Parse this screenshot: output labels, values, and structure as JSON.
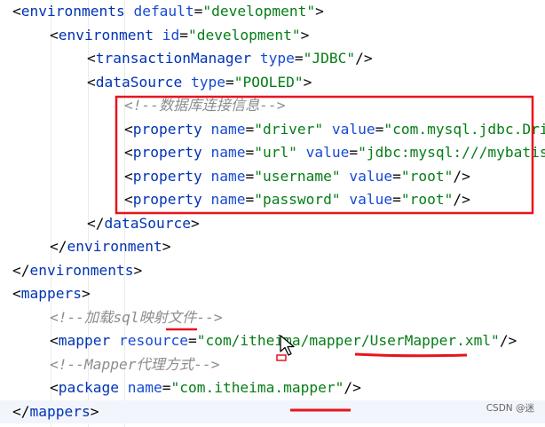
{
  "lines": [
    {
      "level": 0,
      "tokens": [
        {
          "t": "<",
          "c": "punct"
        },
        {
          "t": "environments",
          "c": "tag"
        },
        {
          "t": " default",
          "c": "attr"
        },
        {
          "t": "=",
          "c": "punct"
        },
        {
          "t": "\"development\"",
          "c": "val"
        },
        {
          "t": ">",
          "c": "punct"
        }
      ]
    },
    {
      "level": 1,
      "tokens": [
        {
          "t": "<",
          "c": "punct"
        },
        {
          "t": "environment",
          "c": "tag"
        },
        {
          "t": " id",
          "c": "attr"
        },
        {
          "t": "=",
          "c": "punct"
        },
        {
          "t": "\"development\"",
          "c": "val"
        },
        {
          "t": ">",
          "c": "punct"
        }
      ]
    },
    {
      "level": 2,
      "tokens": [
        {
          "t": "<",
          "c": "punct"
        },
        {
          "t": "transactionManager",
          "c": "tag"
        },
        {
          "t": " type",
          "c": "attr"
        },
        {
          "t": "=",
          "c": "punct"
        },
        {
          "t": "\"JDBC\"",
          "c": "val"
        },
        {
          "t": "/>",
          "c": "punct"
        }
      ]
    },
    {
      "level": 2,
      "tokens": [
        {
          "t": "<",
          "c": "punct"
        },
        {
          "t": "dataSource",
          "c": "tag"
        },
        {
          "t": " type",
          "c": "attr"
        },
        {
          "t": "=",
          "c": "punct"
        },
        {
          "t": "\"POOLED\"",
          "c": "val"
        },
        {
          "t": ">",
          "c": "punct"
        }
      ]
    },
    {
      "level": 3,
      "tokens": [
        {
          "t": "<!--数据库连接信息-->",
          "c": "cmt"
        }
      ]
    },
    {
      "level": 3,
      "tokens": [
        {
          "t": "<",
          "c": "punct"
        },
        {
          "t": "property",
          "c": "tag"
        },
        {
          "t": " name",
          "c": "attr"
        },
        {
          "t": "=",
          "c": "punct"
        },
        {
          "t": "\"driver\"",
          "c": "val"
        },
        {
          "t": " value",
          "c": "attr"
        },
        {
          "t": "=",
          "c": "punct"
        },
        {
          "t": "\"com.mysql.jdbc.Driver\"",
          "c": "val"
        },
        {
          "t": "/>",
          "c": "punct"
        }
      ]
    },
    {
      "level": 3,
      "tokens": [
        {
          "t": "<",
          "c": "punct"
        },
        {
          "t": "property",
          "c": "tag"
        },
        {
          "t": " name",
          "c": "attr"
        },
        {
          "t": "=",
          "c": "punct"
        },
        {
          "t": "\"url\"",
          "c": "val"
        },
        {
          "t": " value",
          "c": "attr"
        },
        {
          "t": "=",
          "c": "punct"
        },
        {
          "t": "\"jdbc:mysql:///mybatis\"",
          "c": "val"
        },
        {
          "t": "/>",
          "c": "punct"
        }
      ]
    },
    {
      "level": 3,
      "tokens": [
        {
          "t": "<",
          "c": "punct"
        },
        {
          "t": "property",
          "c": "tag"
        },
        {
          "t": " name",
          "c": "attr"
        },
        {
          "t": "=",
          "c": "punct"
        },
        {
          "t": "\"username\"",
          "c": "val"
        },
        {
          "t": " value",
          "c": "attr"
        },
        {
          "t": "=",
          "c": "punct"
        },
        {
          "t": "\"root\"",
          "c": "val"
        },
        {
          "t": "/>",
          "c": "punct"
        }
      ]
    },
    {
      "level": 3,
      "tokens": [
        {
          "t": "<",
          "c": "punct"
        },
        {
          "t": "property",
          "c": "tag"
        },
        {
          "t": " name",
          "c": "attr"
        },
        {
          "t": "=",
          "c": "punct"
        },
        {
          "t": "\"password\"",
          "c": "val"
        },
        {
          "t": " value",
          "c": "attr"
        },
        {
          "t": "=",
          "c": "punct"
        },
        {
          "t": "\"root\"",
          "c": "val"
        },
        {
          "t": "/>",
          "c": "punct"
        }
      ]
    },
    {
      "level": 2,
      "tokens": [
        {
          "t": "</",
          "c": "punct"
        },
        {
          "t": "dataSource",
          "c": "tag"
        },
        {
          "t": ">",
          "c": "punct"
        }
      ]
    },
    {
      "level": 1,
      "tokens": [
        {
          "t": "</",
          "c": "punct"
        },
        {
          "t": "environment",
          "c": "tag"
        },
        {
          "t": ">",
          "c": "punct"
        }
      ]
    },
    {
      "level": 0,
      "tokens": [
        {
          "t": "</",
          "c": "punct"
        },
        {
          "t": "environments",
          "c": "tag"
        },
        {
          "t": ">",
          "c": "punct"
        }
      ]
    },
    {
      "level": 0,
      "tokens": [
        {
          "t": "<",
          "c": "punct"
        },
        {
          "t": "mappers",
          "c": "tag"
        },
        {
          "t": ">",
          "c": "punct"
        }
      ]
    },
    {
      "level": 1,
      "tokens": [
        {
          "t": "<!--加载sql映射文件-->",
          "c": "cmt"
        }
      ]
    },
    {
      "level": 1,
      "tokens": [
        {
          "t": "<",
          "c": "punct"
        },
        {
          "t": "mapper",
          "c": "tag"
        },
        {
          "t": " resource",
          "c": "attr"
        },
        {
          "t": "=",
          "c": "punct"
        },
        {
          "t": "\"com/itheima/mapper/UserMapper.xml\"",
          "c": "val"
        },
        {
          "t": "/>",
          "c": "punct"
        }
      ]
    },
    {
      "level": 1,
      "tokens": [
        {
          "t": "<!--Mapper代理方式-->",
          "c": "cmt"
        }
      ]
    },
    {
      "level": 1,
      "tokens": [
        {
          "t": "<",
          "c": "punct"
        },
        {
          "t": "package",
          "c": "tag"
        },
        {
          "t": " name",
          "c": "attr"
        },
        {
          "t": "=",
          "c": "punct"
        },
        {
          "t": "\"com.itheima.mapper\"",
          "c": "val"
        },
        {
          "t": "/>",
          "c": "punct"
        }
      ]
    },
    {
      "level": 0,
      "current": true,
      "tokens": [
        {
          "t": "</",
          "c": "punct"
        },
        {
          "t": "mappers",
          "c": "tag"
        },
        {
          "t": ">",
          "c": "punct"
        }
      ]
    }
  ],
  "annotation_color": "#e8141b",
  "watermark": "CSDN @迷 ",
  "icons": [
    "cursor-arrow-icon"
  ]
}
